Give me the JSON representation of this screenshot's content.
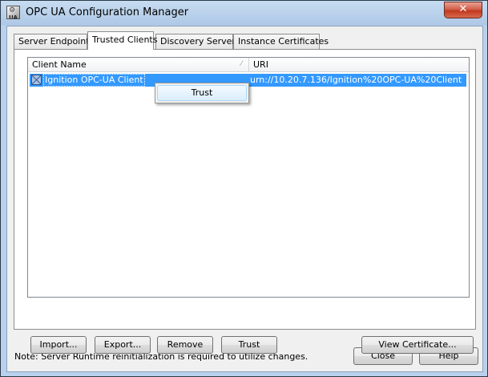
{
  "window": {
    "title": "OPC UA Configuration Manager",
    "icon": "opc-ua-app-icon",
    "icon_text": "UA",
    "close_glyph": "✕"
  },
  "tabs": [
    {
      "label": "Server Endpoints",
      "active": false
    },
    {
      "label": "Trusted Clients",
      "active": true
    },
    {
      "label": "Discovery Servers",
      "active": false
    },
    {
      "label": "Instance Certificates",
      "active": false
    }
  ],
  "list": {
    "columns": {
      "name": "Client Name",
      "uri": "URI"
    },
    "rows": [
      {
        "name": "Ignition OPC-UA Client",
        "uri": "urn://10.20.7.136/Ignition%20OPC-UA%20Client",
        "selected": true
      }
    ]
  },
  "context_menu": {
    "items": [
      "Trust"
    ]
  },
  "panel_buttons": {
    "import": "Import...",
    "export": "Export...",
    "remove": "Remove",
    "trust": "Trust",
    "view_certificate": "View Certificate..."
  },
  "note": "Note:  Server Runtime reinitialization is required to utilize changes.",
  "footer_buttons": {
    "close": "Close",
    "help": "Help"
  },
  "colors": {
    "selection": "#3399ff",
    "close_button": "#c7432a"
  }
}
